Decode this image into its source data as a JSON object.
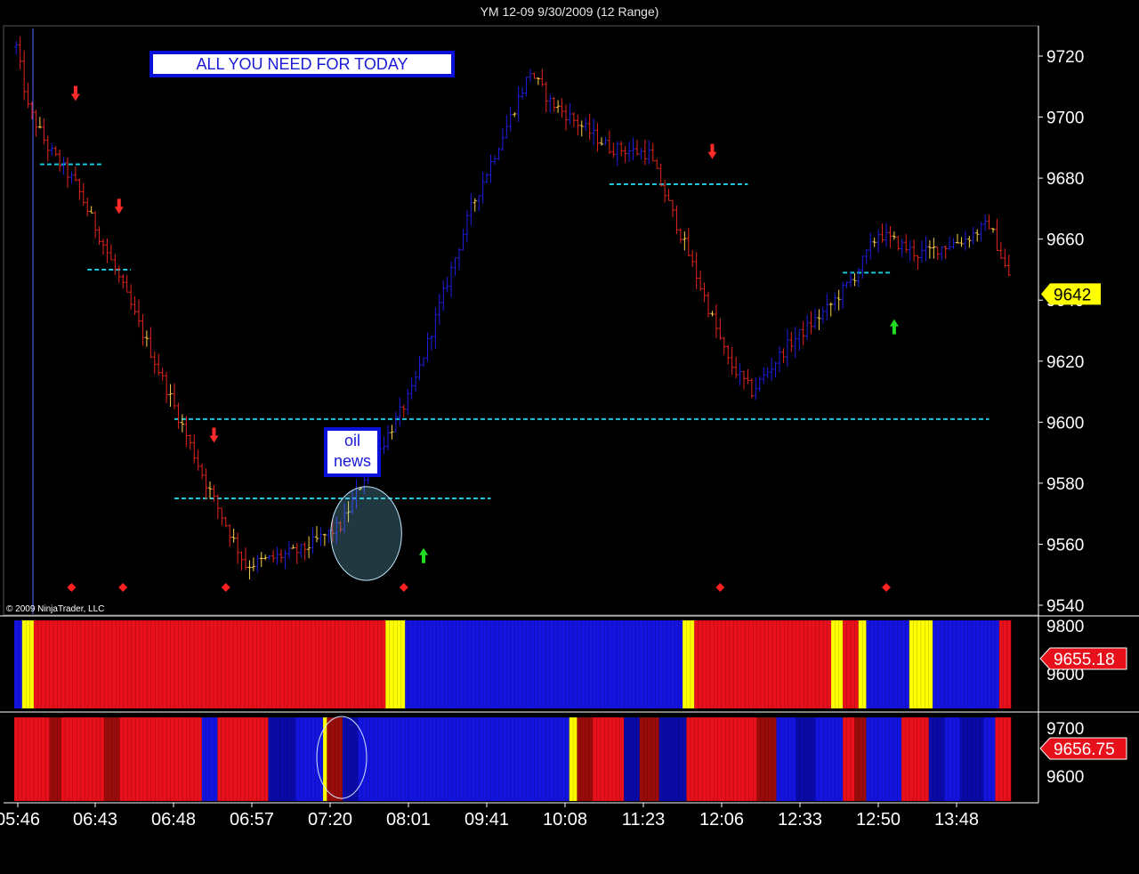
{
  "window": {
    "title": "YM 12-09  9/30/2009 (12 Range)"
  },
  "annotations": {
    "headline": "ALL YOU NEED FOR TODAY",
    "oil_news": [
      "oil",
      "news"
    ],
    "copyright": "© 2009 NinjaTrader, LLC"
  },
  "colors": {
    "down_bar": "#e8231b",
    "up_bar": "#1e1ee6",
    "doji_bar": "#ffd24a",
    "level_line": "#18c8dc",
    "price_tag": "#ffff00",
    "indicator_tag": "#e8101a",
    "background": "#000000"
  },
  "chart_data": [
    {
      "type": "candlestick",
      "panel": "price",
      "title": "YM 12-09  9/30/2009 (12 Range)",
      "bar_type": "12 Range",
      "y_ticks": [
        9720,
        9700,
        9680,
        9660,
        9640,
        9620,
        9600,
        9580,
        9560,
        9540
      ],
      "ylim": [
        9537,
        9732
      ],
      "x_ticks": [
        "05:46",
        "06:43",
        "06:48",
        "06:57",
        "07:20",
        "08:01",
        "09:41",
        "10:08",
        "11:23",
        "12:06",
        "12:33",
        "12:50",
        "13:48"
      ],
      "last_price": 9642,
      "path": [
        [
          0,
          9723
        ],
        [
          3,
          9703
        ],
        [
          8,
          9690
        ],
        [
          15,
          9678
        ],
        [
          25,
          9650
        ],
        [
          40,
          9605
        ],
        [
          48,
          9580
        ],
        [
          58,
          9553
        ],
        [
          72,
          9558
        ],
        [
          82,
          9566
        ],
        [
          88,
          9582
        ],
        [
          100,
          9610
        ],
        [
          115,
          9670
        ],
        [
          130,
          9715
        ],
        [
          135,
          9705
        ],
        [
          150,
          9690
        ],
        [
          160,
          9688
        ],
        [
          170,
          9655
        ],
        [
          180,
          9620
        ],
        [
          186,
          9610
        ],
        [
          195,
          9625
        ],
        [
          205,
          9637
        ],
        [
          212,
          9648
        ],
        [
          218,
          9662
        ],
        [
          228,
          9655
        ],
        [
          240,
          9660
        ],
        [
          246,
          9665
        ],
        [
          252,
          9644
        ]
      ],
      "bar_count": 252,
      "levels": [
        {
          "price": 9684.5,
          "from": 6,
          "to": 22
        },
        {
          "price": 9650,
          "from": 18,
          "to": 29
        },
        {
          "price": 9601,
          "from": 40,
          "to": 246
        },
        {
          "price": 9575,
          "from": 40,
          "to": 120
        },
        {
          "price": 9678,
          "from": 150,
          "to": 185
        },
        {
          "price": 9649,
          "from": 209,
          "to": 221
        }
      ],
      "signals": [
        {
          "bar": 15,
          "direction": "down",
          "price": 9707
        },
        {
          "bar": 26,
          "direction": "down",
          "price": 9670
        },
        {
          "bar": 50,
          "direction": "down",
          "price": 9595
        },
        {
          "bar": 103,
          "direction": "up",
          "price": 9557
        },
        {
          "bar": 176,
          "direction": "down",
          "price": 9688
        },
        {
          "bar": 222,
          "direction": "up",
          "price": 9632
        }
      ],
      "markers": [
        14,
        27,
        53,
        98,
        178,
        220
      ],
      "highlight": {
        "from_bar": 80,
        "to_bar": 97,
        "price_low": 9549,
        "price_high": 9578
      }
    },
    {
      "type": "heatmap",
      "panel": "indicator_1",
      "y_ticks": [
        9800,
        9600
      ],
      "last_value": 9655.18,
      "segments": [
        {
          "from": 0,
          "to": 2,
          "color": "blue"
        },
        {
          "from": 2,
          "to": 5,
          "color": "yellow"
        },
        {
          "from": 5,
          "to": 95,
          "color": "red"
        },
        {
          "from": 95,
          "to": 100,
          "color": "yellow"
        },
        {
          "from": 100,
          "to": 171,
          "color": "blue"
        },
        {
          "from": 171,
          "to": 174,
          "color": "yellow"
        },
        {
          "from": 174,
          "to": 209,
          "color": "red"
        },
        {
          "from": 209,
          "to": 212,
          "color": "yellow"
        },
        {
          "from": 212,
          "to": 216,
          "color": "red"
        },
        {
          "from": 216,
          "to": 218,
          "color": "yellow"
        },
        {
          "from": 218,
          "to": 229,
          "color": "blue"
        },
        {
          "from": 229,
          "to": 235,
          "color": "yellow"
        },
        {
          "from": 235,
          "to": 252,
          "color": "blue"
        },
        {
          "from": 252,
          "to": 255,
          "color": "red"
        }
      ]
    },
    {
      "type": "heatmap",
      "panel": "indicator_2",
      "y_ticks": [
        9700,
        9600
      ],
      "last_value": 9656.75,
      "segments": [
        {
          "from": 0,
          "to": 9,
          "color": "red"
        },
        {
          "from": 9,
          "to": 12,
          "color": "darkred"
        },
        {
          "from": 12,
          "to": 23,
          "color": "red"
        },
        {
          "from": 23,
          "to": 27,
          "color": "darkred"
        },
        {
          "from": 27,
          "to": 48,
          "color": "red"
        },
        {
          "from": 48,
          "to": 52,
          "color": "blue"
        },
        {
          "from": 52,
          "to": 65,
          "color": "red"
        },
        {
          "from": 65,
          "to": 72,
          "color": "navy"
        },
        {
          "from": 72,
          "to": 79,
          "color": "blue"
        },
        {
          "from": 79,
          "to": 80,
          "color": "yellow"
        },
        {
          "from": 80,
          "to": 84,
          "color": "darkred"
        },
        {
          "from": 84,
          "to": 88,
          "color": "navy"
        },
        {
          "from": 88,
          "to": 95,
          "color": "blue"
        },
        {
          "from": 95,
          "to": 142,
          "color": "blue"
        },
        {
          "from": 142,
          "to": 144,
          "color": "yellow"
        },
        {
          "from": 144,
          "to": 148,
          "color": "darkred"
        },
        {
          "from": 148,
          "to": 156,
          "color": "red"
        },
        {
          "from": 156,
          "to": 160,
          "color": "navy"
        },
        {
          "from": 160,
          "to": 165,
          "color": "darkred"
        },
        {
          "from": 165,
          "to": 172,
          "color": "navy"
        },
        {
          "from": 172,
          "to": 190,
          "color": "red"
        },
        {
          "from": 190,
          "to": 195,
          "color": "darkred"
        },
        {
          "from": 195,
          "to": 200,
          "color": "blue"
        },
        {
          "from": 200,
          "to": 205,
          "color": "navy"
        },
        {
          "from": 205,
          "to": 212,
          "color": "blue"
        },
        {
          "from": 212,
          "to": 215,
          "color": "red"
        },
        {
          "from": 215,
          "to": 218,
          "color": "darkred"
        },
        {
          "from": 218,
          "to": 227,
          "color": "blue"
        },
        {
          "from": 227,
          "to": 234,
          "color": "red"
        },
        {
          "from": 234,
          "to": 238,
          "color": "navy"
        },
        {
          "from": 238,
          "to": 242,
          "color": "blue"
        },
        {
          "from": 242,
          "to": 248,
          "color": "navy"
        },
        {
          "from": 248,
          "to": 251,
          "color": "blue"
        },
        {
          "from": 251,
          "to": 255,
          "color": "red"
        }
      ]
    }
  ]
}
